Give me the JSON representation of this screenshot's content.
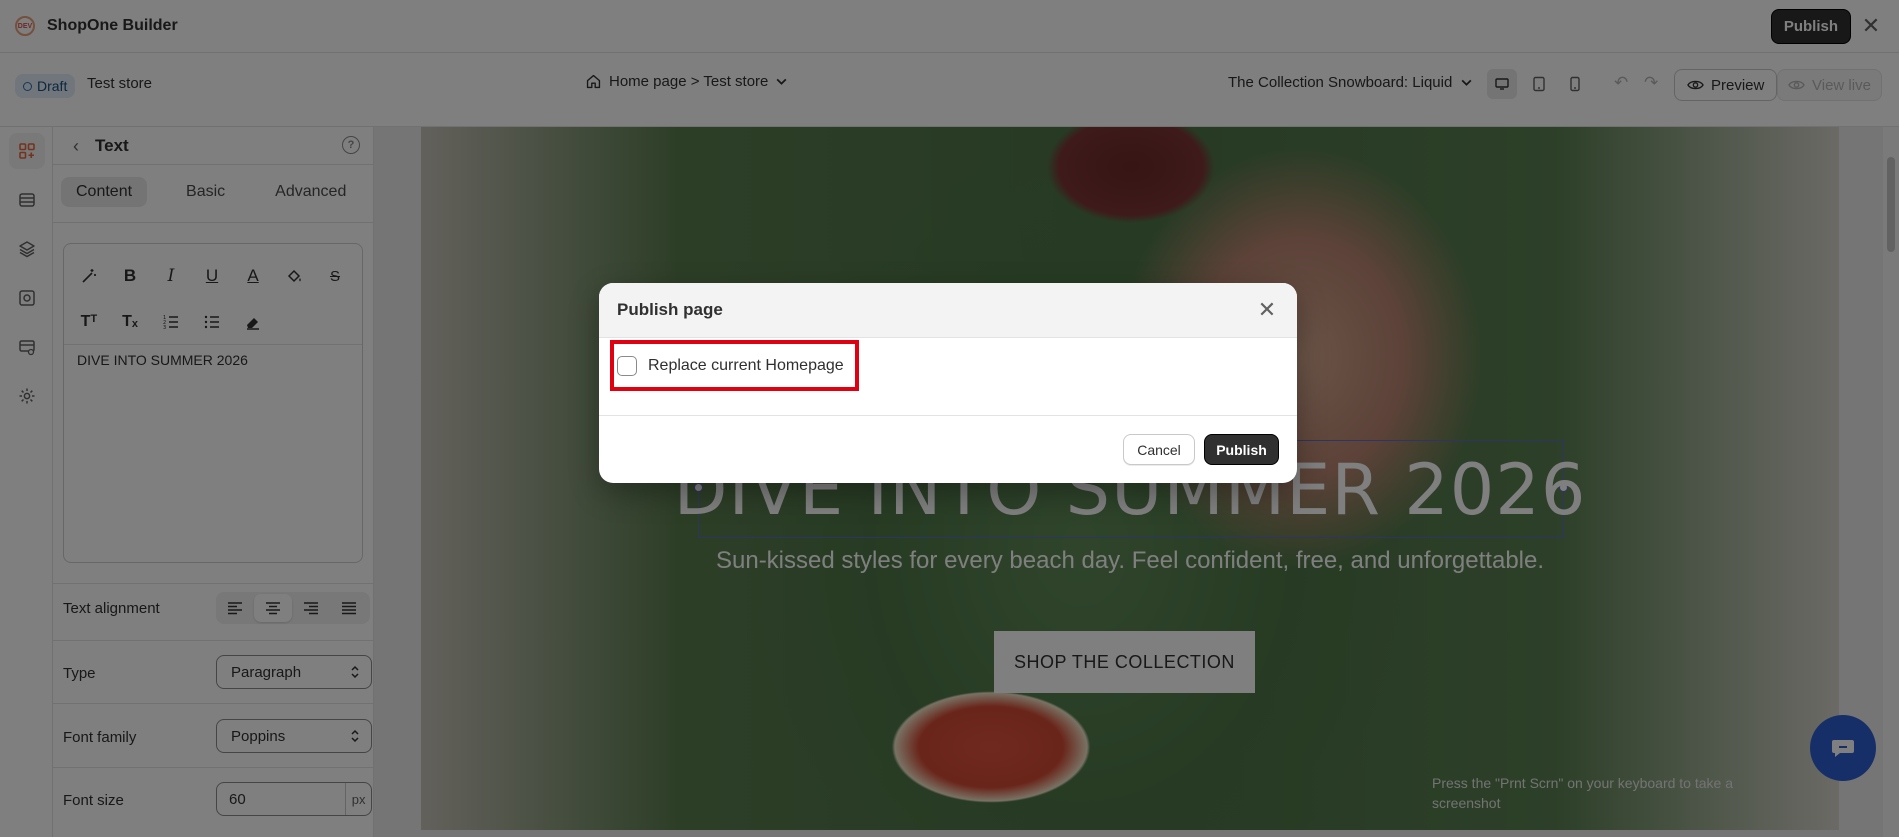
{
  "app": {
    "title": "ShopOne Builder",
    "logo_text": "DEV",
    "publish_label": "Publish"
  },
  "toolbar": {
    "status": "Draft",
    "store": "Test store",
    "page": "Home page > Test store",
    "template": "The Collection Snowboard: Liquid",
    "preview_label": "Preview",
    "view_live_label": "View live"
  },
  "panel": {
    "title": "Text",
    "tabs": [
      {
        "label": "Content"
      },
      {
        "label": "Basic"
      },
      {
        "label": "Advanced"
      }
    ],
    "editor_text": "DIVE INTO SUMMER 2026",
    "text_alignment_label": "Text alignment",
    "type": {
      "label": "Type",
      "value": "Paragraph"
    },
    "font_family": {
      "label": "Font family",
      "value": "Poppins"
    },
    "font_size": {
      "label": "Font size",
      "value": "60",
      "unit": "px"
    }
  },
  "canvas": {
    "hero_title": "DIVE INTO SUMMER 2026",
    "hero_subtitle": "Sun-kissed styles for every beach day. Feel confident, free, and unforgettable.",
    "cta_label": "SHOP THE COLLECTION",
    "hint": "Press the \"Prnt Scrn\" on your keyboard to take a screenshot"
  },
  "modal": {
    "title": "Publish page",
    "checkbox_label": "Replace current Homepage",
    "checkbox_checked": false,
    "cancel_label": "Cancel",
    "publish_label": "Publish"
  },
  "colors": {
    "primary_dark": "#303030",
    "highlight": "#e0000f",
    "selection": "#5c6ac4",
    "chat": "#2f5fd0"
  }
}
